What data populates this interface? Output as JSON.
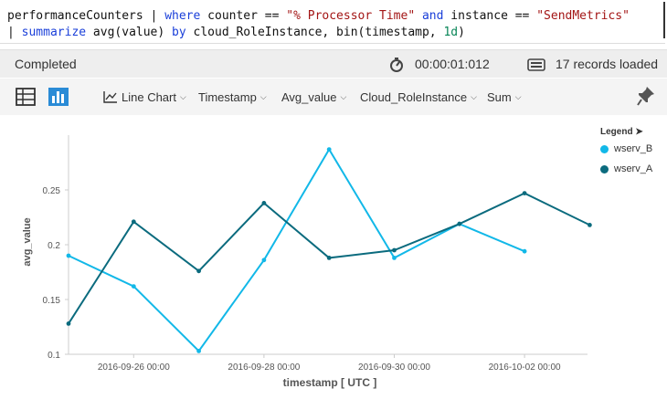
{
  "query": {
    "line1": {
      "t1": "performanceCounters",
      "t2": " | ",
      "t3": "where",
      "t4": " counter == ",
      "t5": "\"% Processor Time\"",
      "t6": " ",
      "t7": "and",
      "t8": " instance == ",
      "t9": "\"SendMetrics\""
    },
    "line2": {
      "t1": "| ",
      "t2": "summarize",
      "t3": " avg(value) ",
      "t4": "by",
      "t5": " cloud_RoleInstance, bin(timestamp, ",
      "t6": "1d",
      "t7": ")"
    }
  },
  "status": {
    "state": "Completed",
    "duration": "00:00:01:012",
    "records": "17 records loaded"
  },
  "toolbar": {
    "chart_type": "Line Chart",
    "x_column": "Timestamp",
    "y_column": "Avg_value",
    "split_column": "Cloud_RoleInstance",
    "aggregation": "Sum"
  },
  "legend": {
    "title": "Legend",
    "items": [
      {
        "name": "wserv_B",
        "color": "#12b8e8"
      },
      {
        "name": "wserv_A",
        "color": "#0b6b7e"
      }
    ]
  },
  "chart_data": {
    "type": "line",
    "xlabel": "timestamp [ UTC ]",
    "ylabel": "avg_value",
    "x_ticks": [
      "2016-09-26 00:00",
      "2016-09-28 00:00",
      "2016-09-30 00:00",
      "2016-10-02 00:00"
    ],
    "y_ticks": [
      "0.1",
      "0.15",
      "0.2",
      "0.25"
    ],
    "x": [
      "2016-09-25",
      "2016-09-26",
      "2016-09-27",
      "2016-09-28",
      "2016-09-29",
      "2016-09-30",
      "2016-10-01",
      "2016-10-02",
      "2016-10-03"
    ],
    "ylim": [
      0.1,
      0.3
    ],
    "series": [
      {
        "name": "wserv_B",
        "color": "#12b8e8",
        "values": [
          0.19,
          0.162,
          0.103,
          0.186,
          0.287,
          0.188,
          0.219,
          0.194,
          null
        ]
      },
      {
        "name": "wserv_A",
        "color": "#0b6b7e",
        "values": [
          0.128,
          0.221,
          0.176,
          0.238,
          0.188,
          0.195,
          0.219,
          0.247,
          0.218
        ]
      }
    ]
  }
}
